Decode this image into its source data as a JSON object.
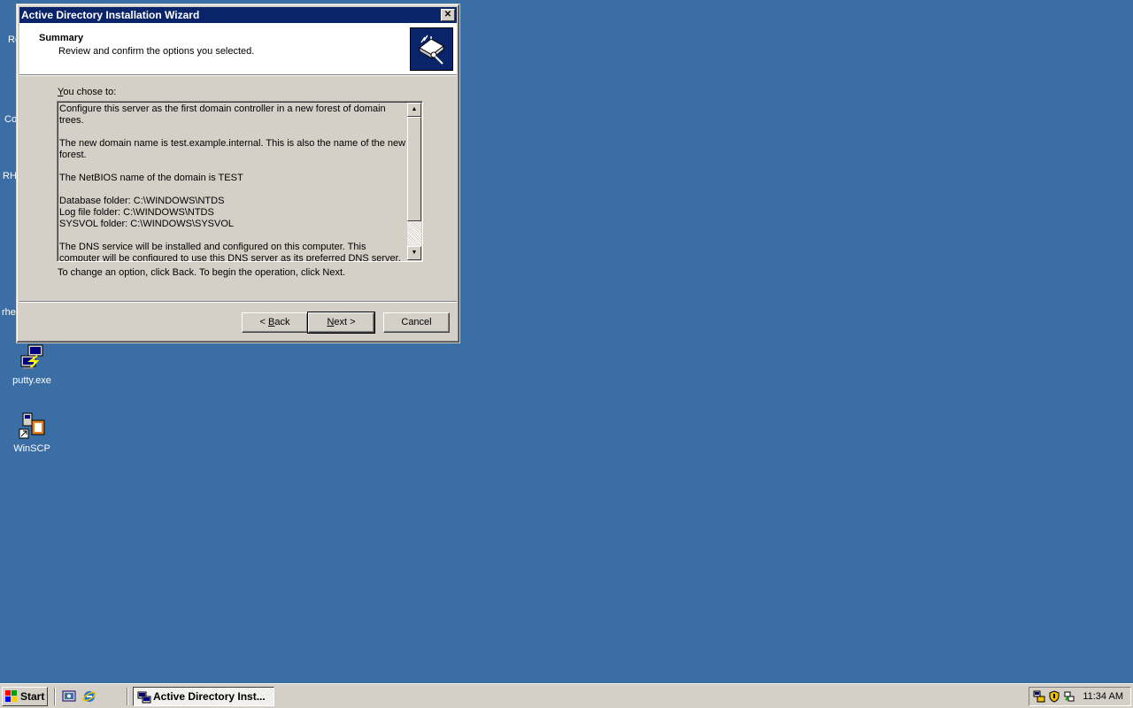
{
  "window": {
    "title": "Active Directory Installation Wizard",
    "close_glyph": "✕",
    "header_title": "Summary",
    "header_subtitle": "Review and confirm the options you selected.",
    "chose_label_first": "Y",
    "chose_label_rest": "ou chose to:",
    "summary_text": "Configure this server as the first domain controller in a new forest of domain trees.\n\nThe new domain name is test.example.internal. This is also the name of the new forest.\n\nThe NetBIOS name of the domain is TEST\n\nDatabase folder: C:\\WINDOWS\\NTDS\nLog file folder: C:\\WINDOWS\\NTDS\nSYSVOL folder: C:\\WINDOWS\\SYSVOL\n\nThe DNS service will be installed and configured on this computer. This computer will be configured to use this DNS server as its preferred DNS server.",
    "change_text": "To change an option, click Back. To begin the operation, click Next.",
    "buttons": {
      "back_prefix": "< ",
      "back_access": "B",
      "back_rest": "ack",
      "next_access": "N",
      "next_rest": "ext >",
      "cancel": "Cancel"
    },
    "scroll_up_glyph": "▲",
    "scroll_down_glyph": "▼"
  },
  "desktop": {
    "partial_labels": [
      "Re",
      "Co",
      "RHI",
      "rhe"
    ],
    "icons": [
      {
        "label": "putty.exe",
        "icon": "putty-icon"
      },
      {
        "label": "WinSCP",
        "icon": "winscp-icon"
      }
    ]
  },
  "taskbar": {
    "start_label": "Start",
    "task_label": "Active Directory Inst...",
    "clock": "11:34 AM"
  },
  "colors": {
    "desktop": "#3a6ea5",
    "titlebar": "#0a246a",
    "face": "#d4d0c8"
  }
}
